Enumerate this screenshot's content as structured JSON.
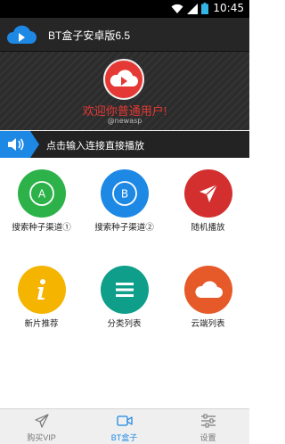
{
  "status_bar": {
    "time": "10:45",
    "icons": [
      "wifi-icon",
      "signal-icon",
      "battery-icon"
    ]
  },
  "header": {
    "title": "BT盒子安卓版6.5",
    "logo_icon": "cloud-play-icon"
  },
  "hero": {
    "greeting": "欢迎你普通用户!",
    "subtitle": "@newasp",
    "logo_icon": "cloud-play-icon"
  },
  "play_bar": {
    "text": "点击输入连接直接播放",
    "icon": "speaker-icon"
  },
  "grid": [
    {
      "label": "搜索种子渠道①",
      "icon": "a-letter-icon",
      "color": "#2db24a"
    },
    {
      "label": "搜索种子渠道②",
      "icon": "b-letter-icon",
      "color": "#1e88e5"
    },
    {
      "label": "随机播放",
      "icon": "paper-plane-icon",
      "color": "#d32f2f"
    },
    {
      "label": "新片推荐",
      "icon": "info-icon",
      "color": "#f4b400"
    },
    {
      "label": "分类列表",
      "icon": "list-icon",
      "color": "#0e9e8a"
    },
    {
      "label": "云端列表",
      "icon": "cloud-icon",
      "color": "#e65a2a"
    }
  ],
  "tabs": [
    {
      "label": "购买VIP",
      "icon": "paper-plane-icon",
      "active": false
    },
    {
      "label": "BT盒子",
      "icon": "video-camera-icon",
      "active": true
    },
    {
      "label": "设置",
      "icon": "sliders-icon",
      "active": false
    }
  ],
  "colors": {
    "accent_blue": "#1e88e5",
    "accent_red": "#e53935",
    "header_bg": "#262626"
  }
}
